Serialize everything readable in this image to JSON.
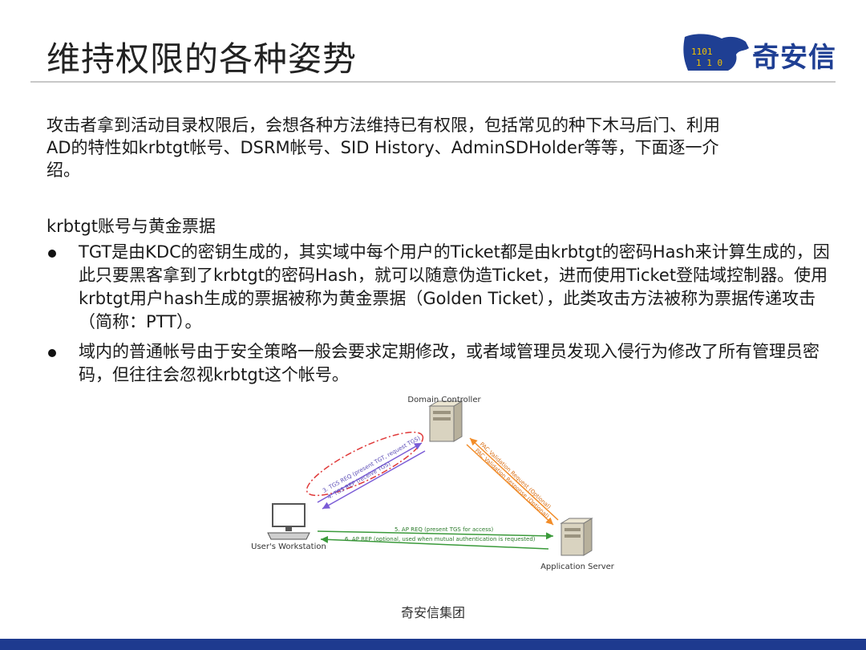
{
  "slide": {
    "title": "维持权限的各种姿势",
    "logo_text": "奇安信",
    "intro": {
      "part1": "攻击者拿到活动目录权限后，会想各种方法维持已有权限，包括常见的种下木马后门、利用",
      "part2": "AD的特性如krbtgt帐号、DSRM帐号、SID History、AdminSDHolder等等，下面逐一介",
      "part3": "绍。"
    },
    "section_title": "krbtgt账号与黄金票据",
    "bullets": [
      "TGT是由KDC的密钥生成的，其实域中每个用户的Ticket都是由krbtgt的密码Hash来计算生成的，因此只要黑客拿到了krbtgt的密码Hash，就可以随意伪造Ticket，进而使用Ticket登陆域控制器。使用krbtgt用户hash生成的票据被称为黄金票据（Golden Ticket），此类攻击方法被称为票据传递攻击（简称：PTT）。",
      "域内的普通帐号由于安全策略一般会要求定期修改，或者域管理员发现入侵行为修改了所有管理员密码，但往往会忽视krbtgt这个帐号。"
    ],
    "footer": "奇安信集团"
  },
  "diagram": {
    "domain_controller": "Domain Controller",
    "workstation": "User's Workstation",
    "app_server": "Application Server",
    "tgs_req": "3. TGS REQ (present TGT, request TGS)",
    "tgs_rep": "4. TGS REP (receive TGS)",
    "pac_req": "PAC Validation Request (Optional)",
    "pac_resp": "PAC Validation Response (Optional)",
    "ap_req": "5. AP REQ (present TGS for access)",
    "ap_rep": "6. AP REP (optional, used when mutual authentication is requested)"
  },
  "colors": {
    "brand_blue": "#1f3f93",
    "footer_bar": "#1e3a8f",
    "tgs_arrow": "#7a5bd6",
    "pac_arrow": "#f28c28",
    "ap_arrow": "#3a9a3a",
    "ellipse": "#e03a3a"
  }
}
